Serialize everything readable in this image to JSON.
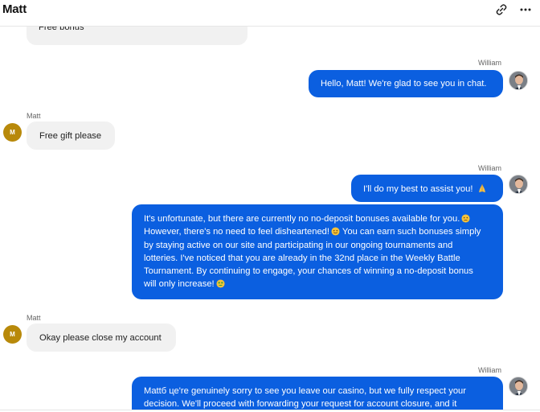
{
  "header": {
    "title": "Matt",
    "link_icon": "link-icon",
    "more_icon": "more-horizontal-icon"
  },
  "colors": {
    "outgoing_bubble": "#0b5fe0",
    "incoming_bubble": "#f1f1f1",
    "user_avatar": "#b8890a"
  },
  "messages": [
    {
      "from": "Matt",
      "text": "Free bonus"
    },
    {
      "from": "William",
      "sender_label": "William",
      "text": "Hello, Matt! We're glad to see you in chat."
    },
    {
      "from": "Matt",
      "sender_label": "Matt",
      "avatar_initial": "M",
      "text": "Free gift please"
    },
    {
      "from": "William",
      "sender_label": "William",
      "text": "I'll do my best to assist you!",
      "emoji": "folded-hands"
    },
    {
      "from": "William",
      "line1": "It's unfortunate, but there are currently no no-deposit bonuses available for you.",
      "line2": "However, there's no need to feel disheartened!",
      "line3": "You can earn such bonuses simply",
      "line4": "by staying active on our site and participating in our ongoing tournaments and",
      "line5": "lotteries. I've noticed that you are already in the 32nd place in the Weekly Battle",
      "line6": "Tournament. By continuing to engage, your chances of winning a no-deposit bonus",
      "line7": "will only increase!",
      "emojis": [
        "sad-face",
        "smiling-face",
        "money-face"
      ]
    },
    {
      "from": "Matt",
      "sender_label": "Matt",
      "avatar_initial": "M",
      "text": "Okay please close my account"
    },
    {
      "from": "William",
      "sender_label": "William",
      "line1": "Mattб це're genuinely sorry to see you leave our casino, but we fully respect your",
      "line2": "decision. We'll proceed with forwarding your request for account closure, and it"
    }
  ]
}
